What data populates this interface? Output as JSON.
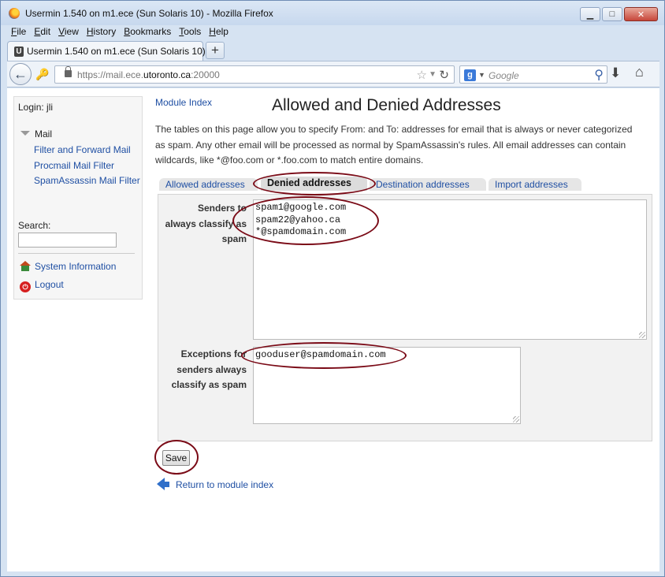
{
  "window": {
    "title": "Usermin 1.540 on m1.ece (Sun Solaris 10) - Mozilla Firefox",
    "minimize": "▁",
    "maximize": "□",
    "close": "✕"
  },
  "menubar": [
    "File",
    "Edit",
    "View",
    "History",
    "Bookmarks",
    "Tools",
    "Help"
  ],
  "browser": {
    "tab_title": "Usermin 1.540 on m1.ece (Sun Solaris 10)",
    "tab_icon_letter": "U",
    "new_tab": "+",
    "url_prefix": "https://mail.ece.",
    "url_domain": "utoronto.ca",
    "url_suffix": ":20000",
    "search_placeholder": "Google",
    "search_engine_letter": "g"
  },
  "sidebar": {
    "login": "Login: jli",
    "section": "Mail",
    "links": [
      "Filter and Forward Mail",
      "Procmail Mail Filter",
      "SpamAssassin Mail Filter"
    ],
    "search_label": "Search:",
    "search_value": "",
    "system_info": "System Information",
    "logout": "Logout"
  },
  "page": {
    "module_index": "Module Index",
    "title": "Allowed and Denied Addresses",
    "intro": "The tables on this page allow you to specify From: and To: addresses for email that is always or never categorized as spam. Any other email will be processed as normal by SpamAssassin's rules. All email addresses can contain wildcards, like *@foo.com or *.foo.com to match entire domains.",
    "tabs": [
      "Allowed addresses",
      "Denied addresses",
      "Destination addresses",
      "Import addresses"
    ],
    "active_tab": "Denied addresses",
    "senders_label": "Senders to always classify as spam",
    "senders_value": "spam1@google.com\nspam22@yahoo.ca\n*@spamdomain.com",
    "exceptions_label": "Exceptions for senders always classify as spam",
    "exceptions_value": "gooduser@spamdomain.com",
    "save_label": "Save",
    "return_link": "Return to module index"
  },
  "annotation_color": "#7a0a16"
}
